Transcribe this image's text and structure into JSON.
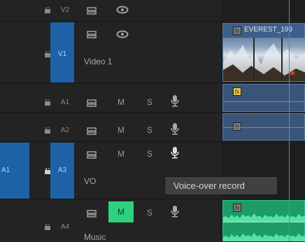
{
  "tracks": {
    "v2": {
      "label": "V2"
    },
    "v1": {
      "label": "V1",
      "name": "Video 1"
    },
    "a1": {
      "label": "A1"
    },
    "a2": {
      "label": "A2"
    },
    "a3": {
      "label": "A3",
      "source_patch": "A1",
      "name": "VO"
    },
    "a4": {
      "label": "A4",
      "name": "Music"
    }
  },
  "buttons": {
    "mute": "M",
    "solo": "S"
  },
  "clips": {
    "video": {
      "fx": "fx",
      "title": "EVEREST_199"
    },
    "a1": {
      "fx": "fx"
    },
    "a2": {
      "fx": "fx"
    },
    "a4": {
      "fx": "fx"
    }
  },
  "tooltip": {
    "text": "Voice-over record"
  },
  "colors": {
    "target_blue": "#1d62a6",
    "mute_active": "#2ed27e",
    "audio_clip": "#3b5578",
    "music_clip": "#1f9c6a",
    "playhead": "#3d8fe0"
  }
}
